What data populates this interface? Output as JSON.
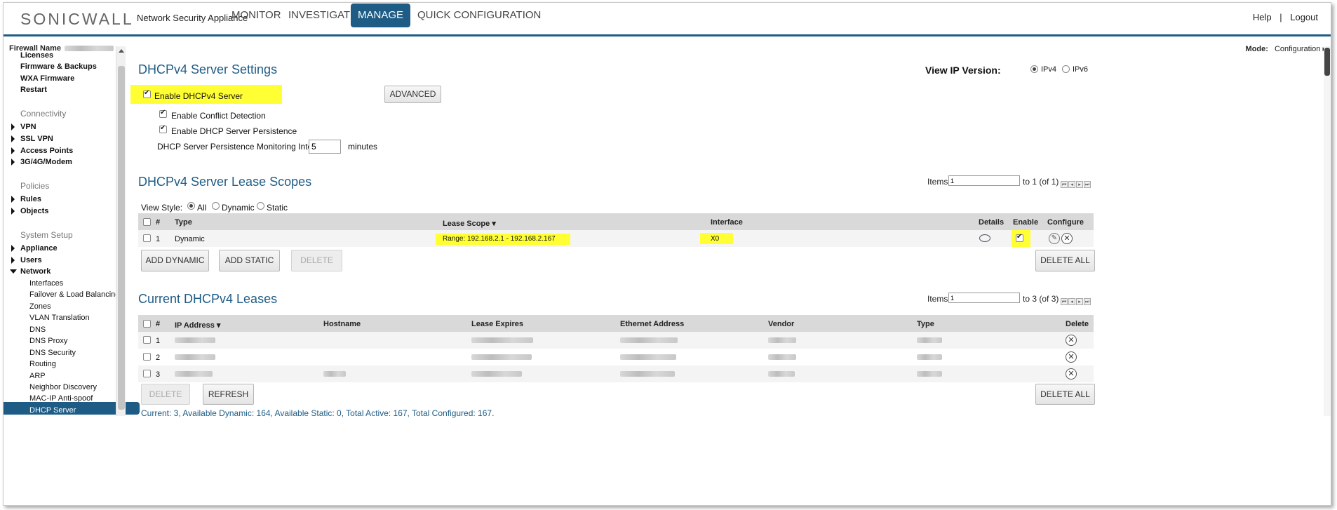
{
  "header": {
    "logo": "SONICWALL",
    "app_name": "Network Security Appliance",
    "nav": [
      "MONITOR",
      "INVESTIGATE",
      "MANAGE",
      "QUICK CONFIGURATION"
    ],
    "active_nav": "MANAGE",
    "help": "Help",
    "separator": "|",
    "logout": "Logout"
  },
  "subheader": {
    "firewall_name_label": "Firewall Name",
    "mode_label": "Mode:",
    "mode_value": "Configuration ▸"
  },
  "sidebar": {
    "top_items": [
      "Licenses",
      "Firmware & Backups",
      "WXA Firmware",
      "Restart"
    ],
    "connectivity_head": "Connectivity",
    "connectivity": [
      "VPN",
      "SSL VPN",
      "Access Points",
      "3G/4G/Modem"
    ],
    "policies_head": "Policies",
    "policies": [
      "Rules",
      "Objects"
    ],
    "system_head": "System Setup",
    "system": [
      "Appliance",
      "Users",
      "Network"
    ],
    "network_sub": [
      "Interfaces",
      "Failover & Load Balancing",
      "Zones",
      "VLAN Translation",
      "DNS",
      "DNS Proxy",
      "DNS Security",
      "Routing",
      "ARP",
      "Neighbor Discovery",
      "MAC-IP Anti-spoof",
      "DHCP Server"
    ]
  },
  "settings": {
    "title": "DHCPv4 Server Settings",
    "enable_server": "Enable DHCPv4 Server",
    "advanced": "ADVANCED",
    "conflict": "Enable Conflict Detection",
    "persistence": "Enable DHCP Server Persistence",
    "interval_label": "DHCP Server Persistence Monitoring Interval:",
    "interval_value": "5",
    "interval_unit": "minutes",
    "view_ip_label": "View IP Version:",
    "ipv4": "IPv4",
    "ipv6": "IPv6"
  },
  "scopes": {
    "title": "DHCPv4 Server Lease Scopes",
    "items_label": "Items",
    "items_value": "1",
    "items_range": "to 1 (of 1)",
    "view_style_label": "View Style:",
    "view_all": "All",
    "view_dynamic": "Dynamic",
    "view_static": "Static",
    "headers": [
      "#",
      "Type",
      "Lease Scope",
      "Interface",
      "Details",
      "Enable",
      "Configure"
    ],
    "rows": [
      {
        "num": "1",
        "type": "Dynamic",
        "scope": "Range: 192.168.2.1 - 192.168.2.167",
        "interface": "X0"
      }
    ],
    "add_dynamic": "ADD DYNAMIC",
    "add_static": "ADD STATIC",
    "delete": "DELETE",
    "delete_all": "DELETE ALL"
  },
  "leases": {
    "title": "Current DHCPv4 Leases",
    "items_label": "Items",
    "items_value": "1",
    "items_range": "to 3 (of 3)",
    "headers": [
      "#",
      "IP Address",
      "Hostname",
      "Lease Expires",
      "Ethernet Address",
      "Vendor",
      "Type",
      "Delete"
    ],
    "rows": [
      {
        "num": "1"
      },
      {
        "num": "2"
      },
      {
        "num": "3"
      }
    ],
    "delete": "DELETE",
    "refresh": "REFRESH",
    "delete_all": "DELETE ALL",
    "status": "Current: 3, Available Dynamic: 164, Available Static: 0, Total Active: 167, Total Configured: 167."
  },
  "colors": {
    "accent": "#1e5c86",
    "highlight": "#ffff33"
  }
}
